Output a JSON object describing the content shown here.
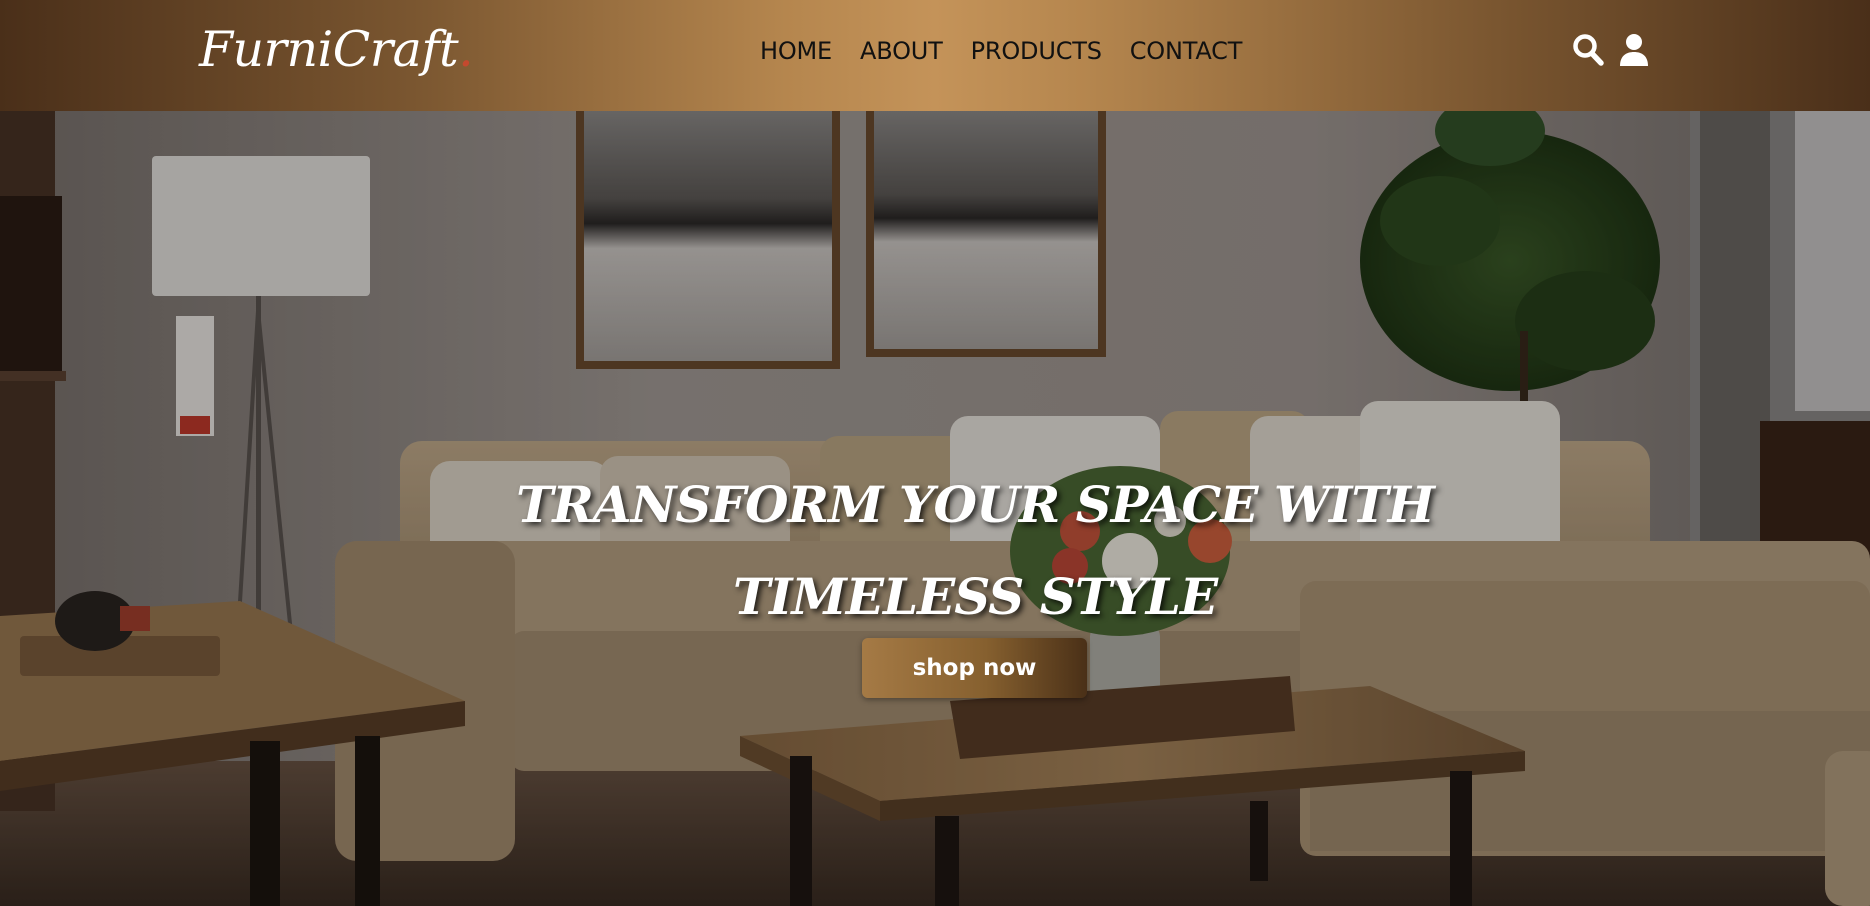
{
  "brand": {
    "name": "FurniCraft",
    "accent_dot": ".",
    "accent_color": "#c4492e"
  },
  "nav": {
    "items": [
      {
        "label": "HOME"
      },
      {
        "label": "ABOUT"
      },
      {
        "label": "PRODUCTS"
      },
      {
        "label": "CONTACT"
      }
    ]
  },
  "header_actions": {
    "search_icon": "search-icon",
    "user_icon": "user-icon"
  },
  "hero": {
    "title": "TRANSFORM YOUR SPACE WITH TIMELESS STYLE",
    "cta_label": "shop now",
    "background": "living-room-photo"
  },
  "colors": {
    "header_gradient_mid": "#c49359",
    "header_gradient_edge": "#4a2f19",
    "button_start": "#a57a45",
    "button_end": "#4a3017",
    "hero_text": "#ffffff",
    "nav_text": "#111111"
  }
}
